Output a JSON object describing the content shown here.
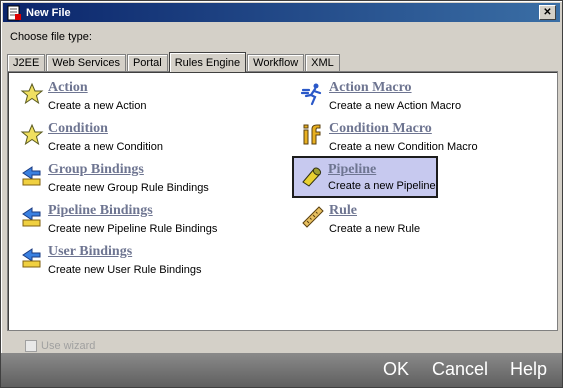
{
  "window": {
    "title": "New File"
  },
  "choose_label": "Choose file type:",
  "tabs": [
    {
      "label": "J2EE",
      "active": false
    },
    {
      "label": "Web Services",
      "active": false
    },
    {
      "label": "Portal",
      "active": false
    },
    {
      "label": "Rules Engine",
      "active": true
    },
    {
      "label": "Workflow",
      "active": false
    },
    {
      "label": "XML",
      "active": false
    }
  ],
  "items": {
    "action": {
      "name": "Action",
      "desc": "Create a new Action",
      "icon": "star-icon"
    },
    "condition": {
      "name": "Condition",
      "desc": "Create a new Condition",
      "icon": "star-icon"
    },
    "group_bindings": {
      "name": "Group Bindings",
      "desc": "Create new Group Rule Bindings",
      "icon": "bindings-arrow-icon"
    },
    "pipeline_bindings": {
      "name": "Pipeline Bindings",
      "desc": "Create new Pipeline Rule Bindings",
      "icon": "bindings-arrow-icon"
    },
    "user_bindings": {
      "name": "User Bindings",
      "desc": "Create new User Rule Bindings",
      "icon": "bindings-arrow-icon"
    },
    "action_macro": {
      "name": "Action Macro",
      "desc": "Create a new Action Macro",
      "icon": "running-figure-icon"
    },
    "condition_macro": {
      "name": "Condition Macro",
      "desc": "Create a new Condition Macro",
      "icon": "if-icon"
    },
    "pipeline": {
      "name": "Pipeline",
      "desc": "Create a new Pipeline",
      "icon": "pipe-icon",
      "selected": true
    },
    "rule": {
      "name": "Rule",
      "desc": "Create a new Rule",
      "icon": "ruler-icon"
    }
  },
  "wizard": {
    "label": "Use wizard",
    "checked": false,
    "enabled": false
  },
  "buttons": {
    "ok": "OK",
    "cancel": "Cancel",
    "help": "Help"
  },
  "colors": {
    "titlebar": "#0a246a",
    "link": "#6e7591",
    "selection": "#c7c9ef",
    "button_bar": "#6e6e6e"
  }
}
